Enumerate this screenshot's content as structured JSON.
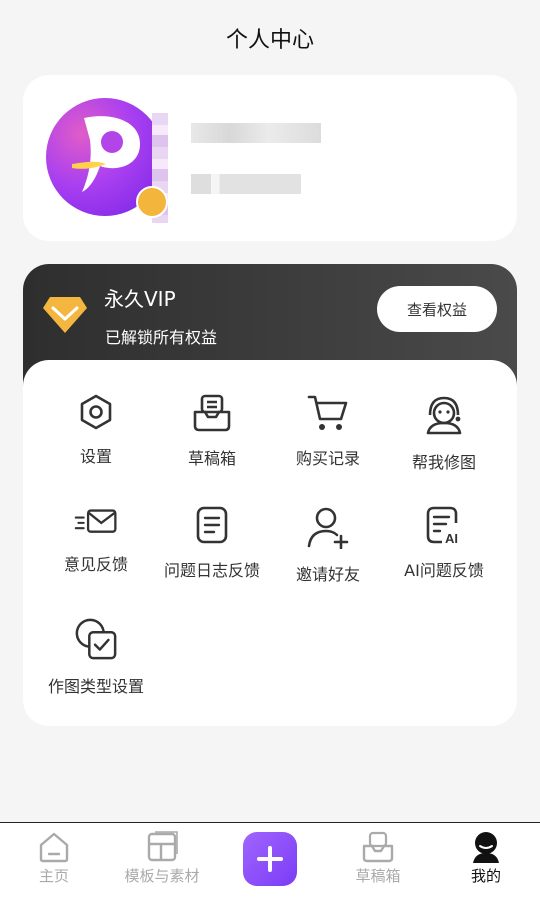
{
  "header": {
    "title": "个人中心"
  },
  "profile": {
    "avatar_icon": "app-logo-avatar",
    "badge_icon": "level-badge"
  },
  "vip": {
    "title": "永久VIP",
    "subtitle": "已解锁所有权益",
    "button_label": "查看权益",
    "accent_color": "#f5b63f"
  },
  "menu": {
    "items": [
      {
        "label": "设置",
        "icon": "gear-icon"
      },
      {
        "label": "草稿箱",
        "icon": "inbox-icon"
      },
      {
        "label": "购买记录",
        "icon": "cart-icon"
      },
      {
        "label": "帮我修图",
        "icon": "support-agent-icon"
      },
      {
        "label": "意见反馈",
        "icon": "mail-icon"
      },
      {
        "label": "问题日志反馈",
        "icon": "document-icon"
      },
      {
        "label": "邀请好友",
        "icon": "add-user-icon"
      },
      {
        "label": "AI问题反馈",
        "icon": "ai-document-icon"
      },
      {
        "label": "作图类型设置",
        "icon": "checkbox-overlap-icon"
      }
    ]
  },
  "tabbar": {
    "tabs": [
      {
        "label": "主页",
        "icon": "home-icon"
      },
      {
        "label": "模板与素材",
        "icon": "template-icon"
      },
      {
        "label": "",
        "icon": "plus-icon"
      },
      {
        "label": "草稿箱",
        "icon": "inbox-icon"
      },
      {
        "label": "我的",
        "icon": "profile-icon"
      }
    ],
    "active_color": "#111111",
    "inactive_color": "#aaaaaa",
    "create_color": "#8a4cf7"
  }
}
